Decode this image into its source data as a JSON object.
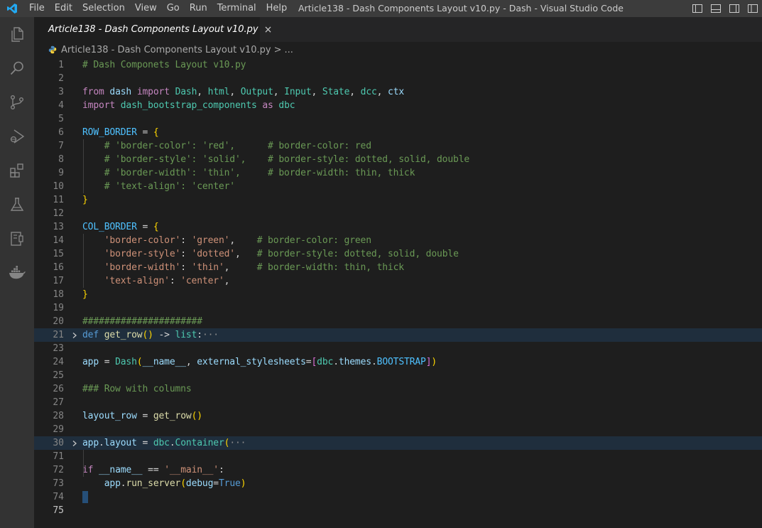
{
  "window": {
    "title": "Article138 - Dash Components Layout v10.py - Dash - Visual Studio Code",
    "menu": [
      "File",
      "Edit",
      "Selection",
      "View",
      "Go",
      "Run",
      "Terminal",
      "Help"
    ]
  },
  "activity_bar": [
    "explorer-icon",
    "search-icon",
    "source-control-icon",
    "run-debug-icon",
    "extensions-icon",
    "testing-icon",
    "remote-explorer-icon",
    "docker-icon"
  ],
  "tab": {
    "label": "Article138 - Dash Components Layout  v10.py",
    "close": "×"
  },
  "breadcrumb": {
    "file": "Article138 - Dash Components Layout  v10.py",
    "separator": ">",
    "more": "..."
  },
  "colors": {
    "accent": "#007acc",
    "editor_bg": "#1e1e1e",
    "comment": "#6a9955",
    "keyword": "#c586c0",
    "string": "#ce9178",
    "function": "#dcdcaa",
    "variable": "#9cdcfe"
  },
  "editor": {
    "lines": [
      {
        "n": "1",
        "tokens": [
          [
            "c-com",
            "# Dash Componets Layout v10.py"
          ]
        ]
      },
      {
        "n": "2",
        "tokens": []
      },
      {
        "n": "3",
        "tokens": [
          [
            "c-kw",
            "from"
          ],
          [
            "c-plain",
            " "
          ],
          [
            "c-var",
            "dash"
          ],
          [
            "c-plain",
            " "
          ],
          [
            "c-kw",
            "import"
          ],
          [
            "c-plain",
            " "
          ],
          [
            "c-cls",
            "Dash"
          ],
          [
            "c-plain",
            ", "
          ],
          [
            "c-cls",
            "html"
          ],
          [
            "c-plain",
            ", "
          ],
          [
            "c-cls",
            "Output"
          ],
          [
            "c-plain",
            ", "
          ],
          [
            "c-cls",
            "Input"
          ],
          [
            "c-plain",
            ", "
          ],
          [
            "c-cls",
            "State"
          ],
          [
            "c-plain",
            ", "
          ],
          [
            "c-cls",
            "dcc"
          ],
          [
            "c-plain",
            ", "
          ],
          [
            "c-var",
            "ctx"
          ]
        ]
      },
      {
        "n": "4",
        "tokens": [
          [
            "c-kw",
            "import"
          ],
          [
            "c-plain",
            " "
          ],
          [
            "c-cls",
            "dash_bootstrap_components"
          ],
          [
            "c-plain",
            " "
          ],
          [
            "c-kw",
            "as"
          ],
          [
            "c-plain",
            " "
          ],
          [
            "c-cls",
            "dbc"
          ]
        ]
      },
      {
        "n": "5",
        "tokens": []
      },
      {
        "n": "6",
        "tokens": [
          [
            "c-const",
            "ROW_BORDER"
          ],
          [
            "c-plain",
            " = "
          ],
          [
            "c-br1",
            "{"
          ]
        ]
      },
      {
        "n": "7",
        "tokens": [
          [
            "c-plain",
            "    "
          ],
          [
            "c-com",
            "# 'border-color': 'red',      # border-color: red"
          ]
        ]
      },
      {
        "n": "8",
        "tokens": [
          [
            "c-plain",
            "    "
          ],
          [
            "c-com",
            "# 'border-style': 'solid',    # border-style: dotted, solid, double"
          ]
        ]
      },
      {
        "n": "9",
        "tokens": [
          [
            "c-plain",
            "    "
          ],
          [
            "c-com",
            "# 'border-width': 'thin',     # border-width: thin, thick"
          ]
        ]
      },
      {
        "n": "10",
        "tokens": [
          [
            "c-plain",
            "    "
          ],
          [
            "c-com",
            "# 'text-align': 'center'"
          ]
        ]
      },
      {
        "n": "11",
        "tokens": [
          [
            "c-br1",
            "}"
          ]
        ]
      },
      {
        "n": "12",
        "tokens": []
      },
      {
        "n": "13",
        "tokens": [
          [
            "c-const",
            "COL_BORDER"
          ],
          [
            "c-plain",
            " = "
          ],
          [
            "c-br1",
            "{"
          ]
        ]
      },
      {
        "n": "14",
        "tokens": [
          [
            "c-plain",
            "    "
          ],
          [
            "c-str",
            "'border-color'"
          ],
          [
            "c-plain",
            ": "
          ],
          [
            "c-str",
            "'green'"
          ],
          [
            "c-plain",
            ",    "
          ],
          [
            "c-com",
            "# border-color: green"
          ]
        ]
      },
      {
        "n": "15",
        "tokens": [
          [
            "c-plain",
            "    "
          ],
          [
            "c-str",
            "'border-style'"
          ],
          [
            "c-plain",
            ": "
          ],
          [
            "c-str",
            "'dotted'"
          ],
          [
            "c-plain",
            ",   "
          ],
          [
            "c-com",
            "# border-style: dotted, solid, double"
          ]
        ]
      },
      {
        "n": "16",
        "tokens": [
          [
            "c-plain",
            "    "
          ],
          [
            "c-str",
            "'border-width'"
          ],
          [
            "c-plain",
            ": "
          ],
          [
            "c-str",
            "'thin'"
          ],
          [
            "c-plain",
            ",     "
          ],
          [
            "c-com",
            "# border-width: thin, thick"
          ]
        ]
      },
      {
        "n": "17",
        "tokens": [
          [
            "c-plain",
            "    "
          ],
          [
            "c-str",
            "'text-align'"
          ],
          [
            "c-plain",
            ": "
          ],
          [
            "c-str",
            "'center'"
          ],
          [
            "c-plain",
            ","
          ]
        ]
      },
      {
        "n": "18",
        "tokens": [
          [
            "c-br1",
            "}"
          ]
        ]
      },
      {
        "n": "19",
        "tokens": []
      },
      {
        "n": "20",
        "tokens": [
          [
            "c-com",
            "######################"
          ]
        ]
      },
      {
        "n": "21",
        "fold": "collapsed",
        "highlight": true,
        "tokens": [
          [
            "c-blue",
            "def"
          ],
          [
            "c-plain",
            " "
          ],
          [
            "c-fn",
            "get_row"
          ],
          [
            "c-br1",
            "()"
          ],
          [
            "c-plain",
            " -> "
          ],
          [
            "c-cls",
            "list"
          ],
          [
            "c-plain",
            ":"
          ],
          [
            "ellipsis",
            "···"
          ]
        ]
      },
      {
        "n": "23",
        "tokens": []
      },
      {
        "n": "24",
        "tokens": [
          [
            "c-var",
            "app"
          ],
          [
            "c-plain",
            " = "
          ],
          [
            "c-cls",
            "Dash"
          ],
          [
            "c-br1",
            "("
          ],
          [
            "c-var",
            "__name__"
          ],
          [
            "c-plain",
            ", "
          ],
          [
            "c-var",
            "external_stylesheets"
          ],
          [
            "c-plain",
            "="
          ],
          [
            "c-br2",
            "["
          ],
          [
            "c-cls",
            "dbc"
          ],
          [
            "c-plain",
            "."
          ],
          [
            "c-var",
            "themes"
          ],
          [
            "c-plain",
            "."
          ],
          [
            "c-const",
            "BOOTSTRAP"
          ],
          [
            "c-br2",
            "]"
          ],
          [
            "c-br1",
            ")"
          ]
        ]
      },
      {
        "n": "25",
        "tokens": []
      },
      {
        "n": "26",
        "tokens": [
          [
            "c-com",
            "### Row with columns"
          ]
        ]
      },
      {
        "n": "27",
        "tokens": []
      },
      {
        "n": "28",
        "tokens": [
          [
            "c-var",
            "layout_row"
          ],
          [
            "c-plain",
            " = "
          ],
          [
            "c-fn",
            "get_row"
          ],
          [
            "c-br1",
            "()"
          ]
        ]
      },
      {
        "n": "29",
        "tokens": []
      },
      {
        "n": "30",
        "fold": "collapsed",
        "highlight": true,
        "tokens": [
          [
            "c-var",
            "app"
          ],
          [
            "c-plain",
            "."
          ],
          [
            "c-var",
            "layout"
          ],
          [
            "c-plain",
            " = "
          ],
          [
            "c-cls",
            "dbc"
          ],
          [
            "c-plain",
            "."
          ],
          [
            "c-cls",
            "Container"
          ],
          [
            "c-br1",
            "("
          ],
          [
            "ellipsis",
            "···"
          ]
        ]
      },
      {
        "n": "71",
        "tokens": []
      },
      {
        "n": "72",
        "tokens": [
          [
            "c-kw",
            "if"
          ],
          [
            "c-plain",
            " "
          ],
          [
            "c-var",
            "__name__"
          ],
          [
            "c-plain",
            " == "
          ],
          [
            "c-str",
            "'__main__'"
          ],
          [
            "c-plain",
            ":"
          ]
        ]
      },
      {
        "n": "73",
        "tokens": [
          [
            "c-plain",
            "    "
          ],
          [
            "c-var",
            "app"
          ],
          [
            "c-plain",
            "."
          ],
          [
            "c-fn",
            "run_server"
          ],
          [
            "c-br1",
            "("
          ],
          [
            "c-var",
            "debug"
          ],
          [
            "c-plain",
            "="
          ],
          [
            "c-blue",
            "True"
          ],
          [
            "c-br1",
            ")"
          ]
        ]
      },
      {
        "n": "74",
        "cursor": true,
        "tokens": []
      },
      {
        "n": "75",
        "current": true,
        "tokens": []
      }
    ]
  }
}
